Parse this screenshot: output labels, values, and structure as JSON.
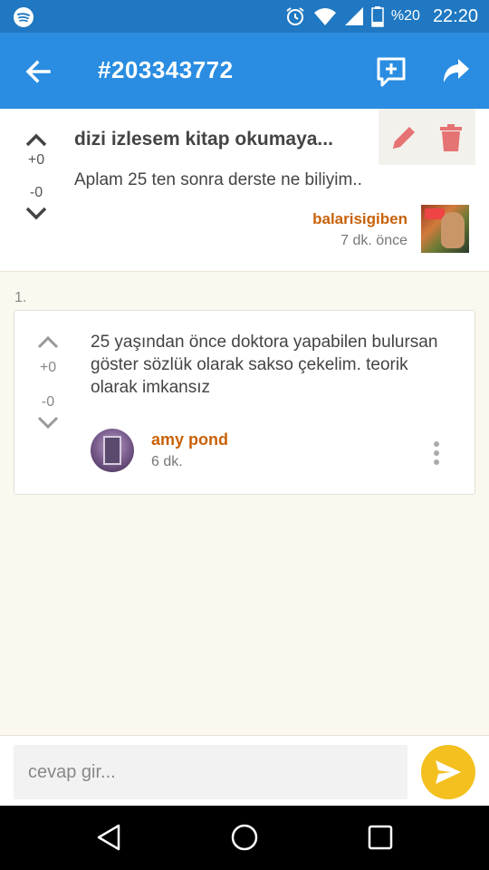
{
  "status_bar": {
    "battery_pct": "%20",
    "time": "22:20"
  },
  "app_bar": {
    "title": "#203343772"
  },
  "topic": {
    "title": "dizi izlesem kitap okumaya...",
    "upvotes": "+0",
    "downvotes": "-0",
    "description": "Aplam 25 ten sonra derste ne biliyim..",
    "author": "balarisigiben",
    "time": "7 dk. önce"
  },
  "entries": [
    {
      "index": "1.",
      "upvotes": "+0",
      "downvotes": "-0",
      "text": "25 yaşından önce doktora yapabilen bulursan göster sözlük olarak sakso çekelim. teorik olarak imkansız",
      "author": "amy pond",
      "time": "6 dk."
    }
  ],
  "reply": {
    "placeholder": "cevap gir..."
  },
  "colors": {
    "status_bar": "#1f78c1",
    "app_bar": "#2a8de1",
    "author": "#c8620a",
    "send_button": "#f4c020",
    "delete_icon": "#e57373",
    "background": "#fbf8ef"
  }
}
